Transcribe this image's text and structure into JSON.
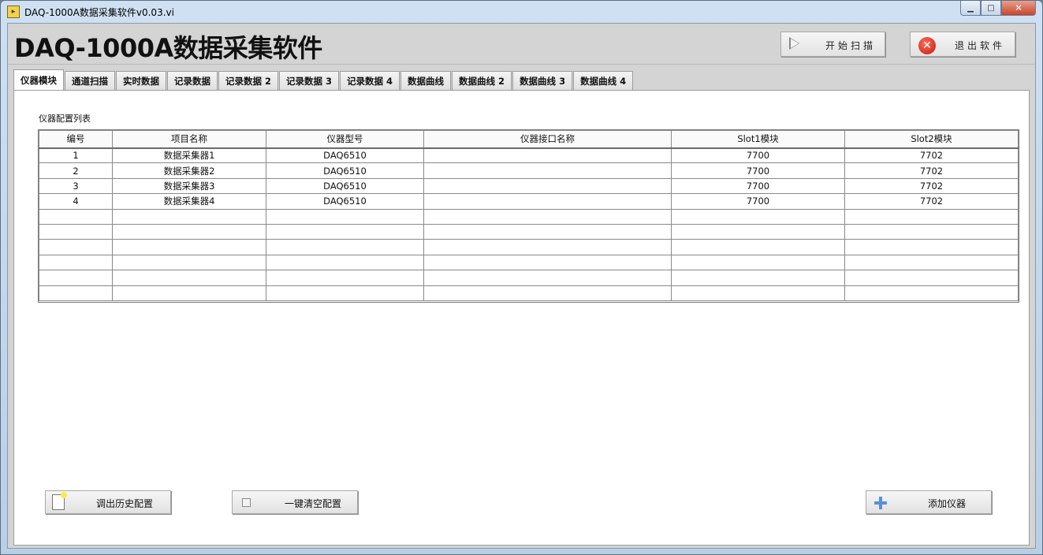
{
  "window": {
    "title": "DAQ-1000A数据采集软件v0.03.vi",
    "app_icon_text": "▸",
    "controls": {
      "minimize": "▁",
      "maximize": "□",
      "close": "✕"
    }
  },
  "header": {
    "title": "DAQ-1000A数据采集软件",
    "start_button": "开始扫描",
    "exit_button": "退出软件"
  },
  "tabs": [
    {
      "label": "仪器模块",
      "active": true
    },
    {
      "label": "通道扫描"
    },
    {
      "label": "实时数据"
    },
    {
      "label": "记录数据"
    },
    {
      "label": "记录数据 2"
    },
    {
      "label": "记录数据 3"
    },
    {
      "label": "记录数据 4"
    },
    {
      "label": "数据曲线"
    },
    {
      "label": "数据曲线 2"
    },
    {
      "label": "数据曲线 3"
    },
    {
      "label": "数据曲线 4"
    }
  ],
  "panel": {
    "table_label": "仪器配置列表",
    "columns": [
      "编号",
      "项目名称",
      "仪器型号",
      "仪器接口名称",
      "Slot1模块",
      "Slot2模块"
    ],
    "rows": [
      [
        "1",
        "数据采集器1",
        "DAQ6510",
        "",
        "7700",
        "7702"
      ],
      [
        "2",
        "数据采集器2",
        "DAQ6510",
        "",
        "7700",
        "7702"
      ],
      [
        "3",
        "数据采集器3",
        "DAQ6510",
        "",
        "7700",
        "7702"
      ],
      [
        "4",
        "数据采集器4",
        "DAQ6510",
        "",
        "7700",
        "7702"
      ],
      [
        "",
        "",
        "",
        "",
        "",
        ""
      ],
      [
        "",
        "",
        "",
        "",
        "",
        ""
      ],
      [
        "",
        "",
        "",
        "",
        "",
        ""
      ],
      [
        "",
        "",
        "",
        "",
        "",
        ""
      ],
      [
        "",
        "",
        "",
        "",
        "",
        ""
      ],
      [
        "",
        "",
        "",
        "",
        "",
        ""
      ]
    ]
  },
  "buttons": {
    "history": "调出历史配置",
    "clear": "一键清空配置",
    "add": "添加仪器"
  },
  "icons": {
    "start": "play-icon",
    "exit": "close-circle-icon",
    "history": "document-icon",
    "clear": "checkbox-icon",
    "add": "plus-icon"
  }
}
